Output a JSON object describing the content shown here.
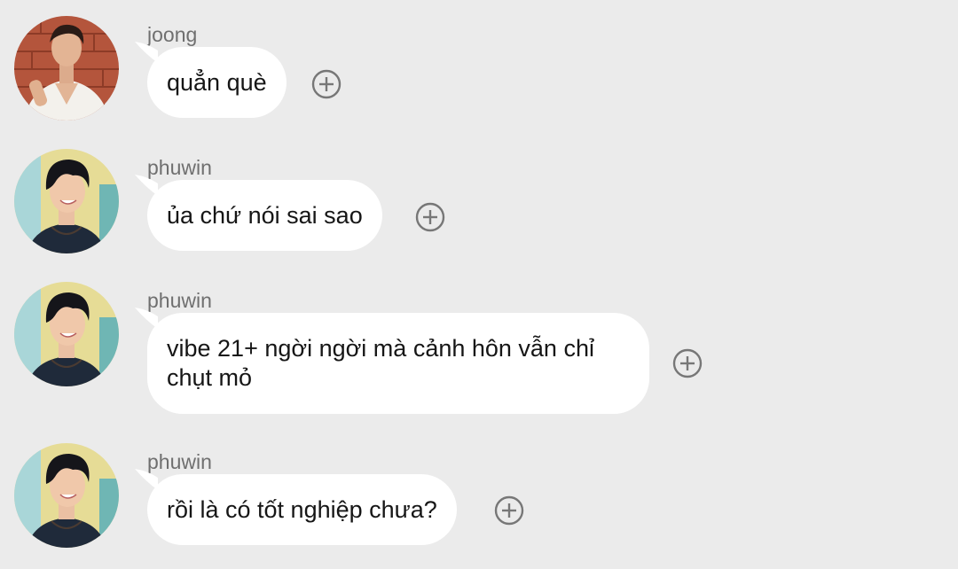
{
  "messages": [
    {
      "sender": "joong",
      "text": "quẳn què",
      "avatar": "joong-avatar",
      "react_icon": "add-reaction-icon"
    },
    {
      "sender": "phuwin",
      "text": "ủa chứ nói sai sao",
      "avatar": "phuwin-avatar",
      "react_icon": "add-reaction-icon"
    },
    {
      "sender": "phuwin",
      "text": "vibe 21+ ngời ngời mà cảnh hôn vẫn chỉ\nchụt mỏ",
      "avatar": "phuwin-avatar",
      "react_icon": "add-reaction-icon"
    },
    {
      "sender": "phuwin",
      "text": "rồi là có tốt nghiệp chưa?",
      "avatar": "phuwin-avatar",
      "react_icon": "add-reaction-icon"
    }
  ],
  "colors": {
    "background": "#ebebeb",
    "bubble": "#ffffff",
    "sender_text": "#6f6f6f",
    "message_text": "#161616",
    "react_icon": "#777777"
  }
}
